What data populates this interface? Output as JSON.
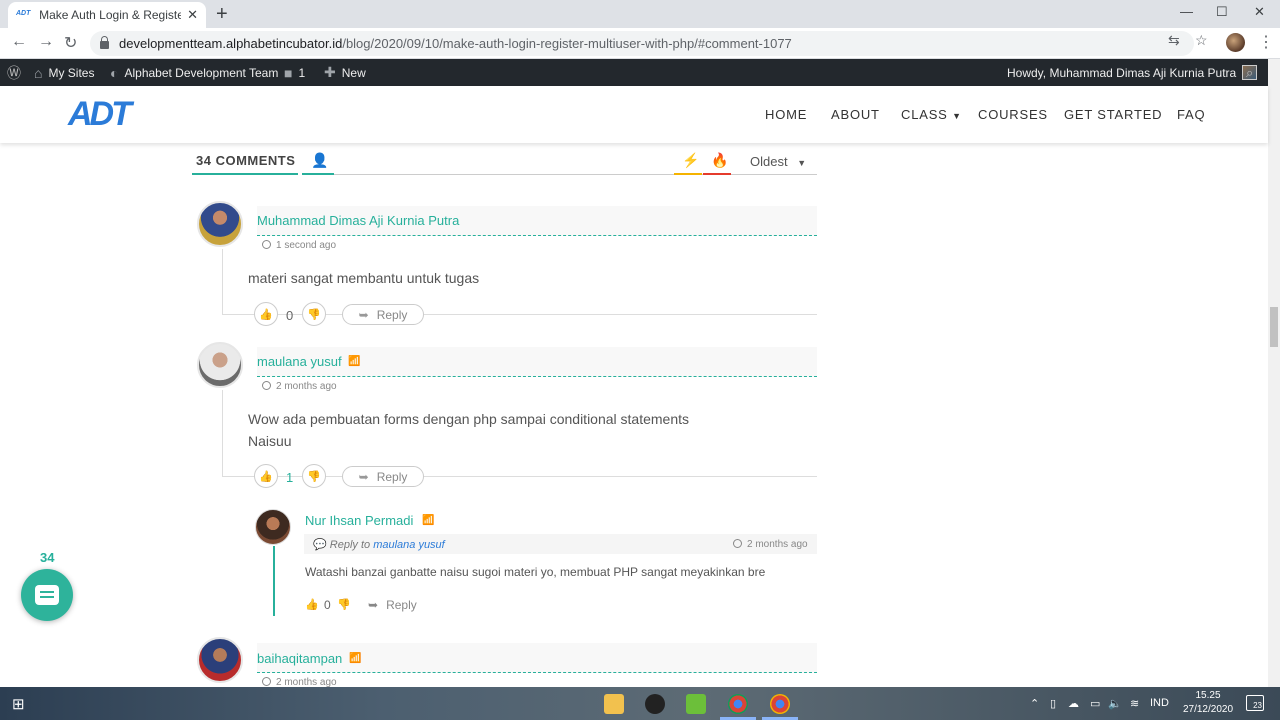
{
  "browser": {
    "tab_title": "Make Auth Login & Register multi",
    "tab_favicon": "ADT",
    "url_host": "developmentteam.alphabetincubator.id",
    "url_path": "/blog/2020/09/10/make-auth-login-register-multiuser-with-php/#comment-1077"
  },
  "adminbar": {
    "my_sites": "My Sites",
    "site_name": "Alphabet Development Team",
    "comments_count": "1",
    "new_label": "New",
    "howdy": "Howdy, Muhammad Dimas Aji Kurnia Putra"
  },
  "site": {
    "logo_text": "ADT",
    "nav": [
      "HOME",
      "ABOUT",
      "CLASS",
      "COURSES",
      "GET STARTED",
      "FAQ"
    ]
  },
  "comments_header": {
    "count_label": "34 COMMENTS",
    "sort_label": "Oldest"
  },
  "comments": [
    {
      "author": "Muhammad Dimas Aji Kurnia Putra",
      "time": "1 second ago",
      "text": "materi sangat membantu untuk tugas",
      "votes": "0",
      "reply_label": "Reply"
    },
    {
      "author": "maulana yusuf",
      "time": "2 months ago",
      "text_line1": "Wow ada pembuatan forms dengan php sampai conditional statements",
      "text_line2": "Naisuu",
      "votes": "1",
      "reply_label": "Reply"
    },
    {
      "author": "Nur Ihsan Permadi",
      "reply_to_prefix": "Reply to",
      "reply_to_name": "maulana yusuf",
      "time": "2 months ago",
      "text": "Watashi banzai ganbatte naisu sugoi materi yo, membuat PHP sangat meyakinkan bre",
      "votes": "0",
      "reply_label": "Reply"
    },
    {
      "author": "baihaqitampan",
      "time": "2 months ago"
    }
  ],
  "floating": {
    "count": "34"
  },
  "taskbar": {
    "lang": "IND",
    "time": "15.25",
    "date": "27/12/2020",
    "notifications": "23"
  },
  "colors": {
    "accent": "#27b09b",
    "link": "#2b7bd8",
    "adminbar": "#23282d"
  }
}
